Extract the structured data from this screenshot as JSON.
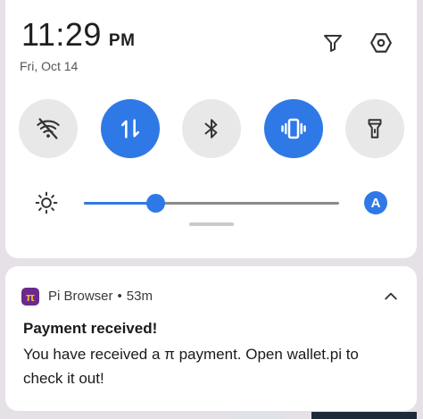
{
  "status": {
    "time": "11:29",
    "ampm": "PM",
    "date": "Fri, Oct 14"
  },
  "top_icons": [
    "filter-icon",
    "settings-icon"
  ],
  "quick_tiles": [
    {
      "icon": "wifi-off-icon",
      "state": "off"
    },
    {
      "icon": "mobile-data-icon",
      "state": "on"
    },
    {
      "icon": "bluetooth-icon",
      "state": "off"
    },
    {
      "icon": "vibrate-icon",
      "state": "on"
    },
    {
      "icon": "flashlight-icon",
      "state": "off"
    }
  ],
  "brightness": {
    "level_percent": 28,
    "auto_label": "A"
  },
  "notification": {
    "app_name": "Pi Browser",
    "separator": "•",
    "age": "53m",
    "title": "Payment received!",
    "body": "You have received a π payment. Open wallet.pi to check it out!"
  },
  "colors": {
    "accent": "#2f79e6",
    "tile_off": "#e8e8e8",
    "pi_brand": "#6b2a8c"
  }
}
